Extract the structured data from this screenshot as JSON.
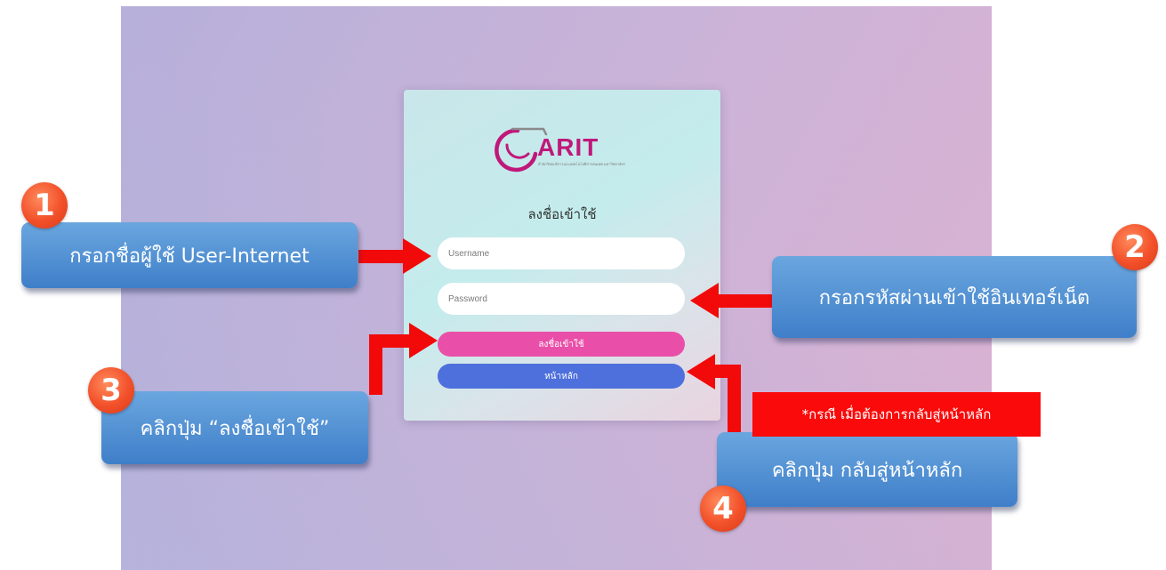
{
  "login": {
    "logo_text": "ARIT",
    "logo_subtitle": "สำนักวิทยบริการและเทคโนโลยีสารสนเทศ มหาวิทยาลัยราชภัฏบ้านสมเด็จเจ้าพระยา",
    "title": "ลงชื่อเข้าใช้",
    "username_placeholder": "Username",
    "password_placeholder": "Password",
    "login_button": "ลงชื่อเข้าใช้",
    "home_button": "หน้าหลัก"
  },
  "callouts": [
    {
      "number": "1",
      "text": "กรอกชื่อผู้ใช้ User-Internet"
    },
    {
      "number": "2",
      "text": "กรอกรหัสผ่านเข้าใช้อินเทอร์เน็ต"
    },
    {
      "number": "3",
      "text": "คลิกปุ่ม “ลงชื่อเข้าใช้”"
    },
    {
      "number": "4",
      "text": "คลิกปุ่ม กลับสู่หน้าหลัก"
    }
  ],
  "note": "*กรณี เมื่อต้องการกลับสู่หน้าหลัก",
  "colors": {
    "logo": "#c0187a",
    "login_button": "#e94fa8",
    "home_button": "#4e70dc",
    "callout": "#4f8fd4",
    "badge": "#f2502a",
    "arrow": "#f20a0a"
  }
}
